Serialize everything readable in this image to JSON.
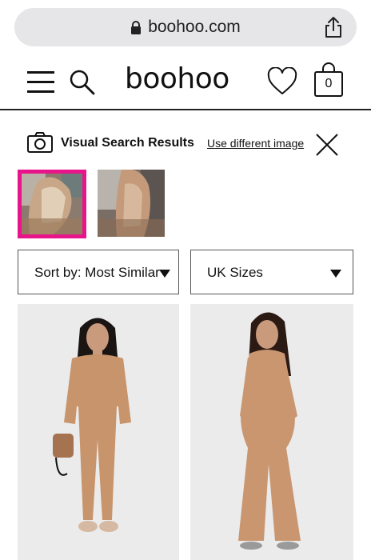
{
  "browser": {
    "url": "boohoo.com",
    "lock_icon": "lock-icon",
    "share_icon": "share-icon"
  },
  "header": {
    "logo": "boohoo",
    "bag_count": "0",
    "icons": [
      "menu-icon",
      "search-icon",
      "heart-icon",
      "bag-icon"
    ]
  },
  "visual_search": {
    "title": "Visual Search Results",
    "change_link": "Use different image",
    "highlight_color": "#e8158a"
  },
  "filters": {
    "sort_label": "Sort by: Most Similar",
    "size_label": "UK Sizes"
  }
}
